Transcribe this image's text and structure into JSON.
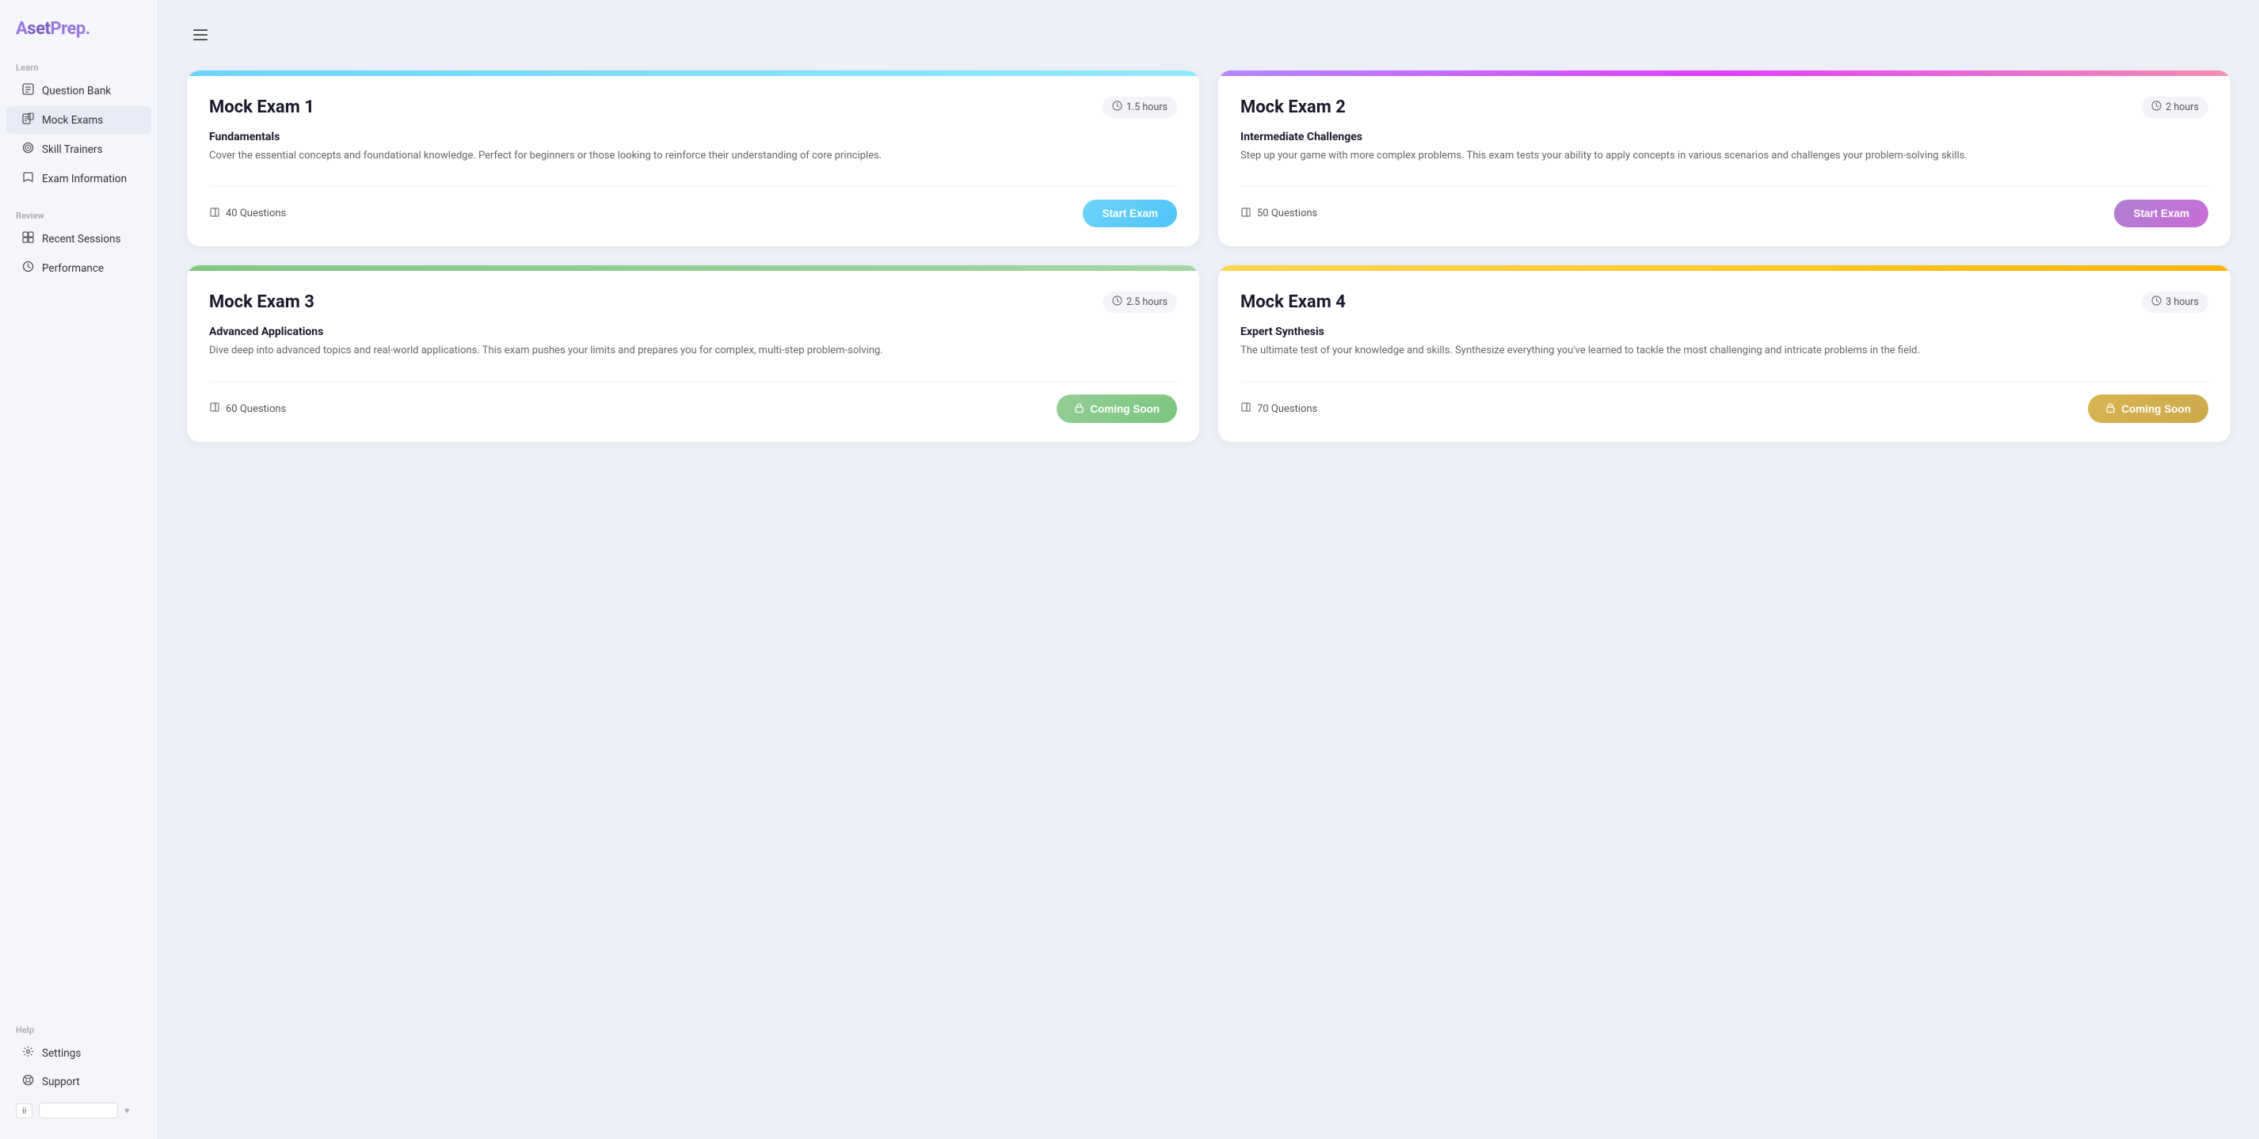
{
  "app": {
    "logo": "AsetPrep.",
    "logo_color_a": "#9b77e0",
    "logo_color_s": "#7c5cbf"
  },
  "sidebar": {
    "learn_label": "Learn",
    "review_label": "Review",
    "help_label": "Help",
    "nav_items_learn": [
      {
        "id": "question-bank",
        "label": "Question Bank",
        "icon": "☐"
      },
      {
        "id": "mock-exams",
        "label": "Mock Exams",
        "icon": "📋"
      },
      {
        "id": "skill-trainers",
        "label": "Skill Trainers",
        "icon": "🎯"
      },
      {
        "id": "exam-information",
        "label": "Exam Information",
        "icon": "📖"
      }
    ],
    "nav_items_review": [
      {
        "id": "recent-sessions",
        "label": "Recent Sessions",
        "icon": "⊞"
      },
      {
        "id": "performance",
        "label": "Performance",
        "icon": "⏱"
      }
    ],
    "nav_items_help": [
      {
        "id": "settings",
        "label": "Settings",
        "icon": "⚙"
      },
      {
        "id": "support",
        "label": "Support",
        "icon": "⊙"
      }
    ],
    "version": "ii",
    "version_placeholder": ""
  },
  "toolbar": {
    "toggle_label": "⊟"
  },
  "exams": [
    {
      "id": "mock-exam-1",
      "title": "Mock Exam 1",
      "duration": "1.5 hours",
      "subtitle": "Fundamentals",
      "description": "Cover the essential concepts and foundational knowledge. Perfect for beginners or those looking to reinforce their understanding of core principles.",
      "questions": "40 Questions",
      "cta_label": "Start Exam",
      "cta_type": "start",
      "card_class": "card-1",
      "btn_class": "btn-start-1"
    },
    {
      "id": "mock-exam-2",
      "title": "Mock Exam 2",
      "duration": "2 hours",
      "subtitle": "Intermediate Challenges",
      "description": "Step up your game with more complex problems. This exam tests your ability to apply concepts in various scenarios and challenges your problem-solving skills.",
      "questions": "50 Questions",
      "cta_label": "Start Exam",
      "cta_type": "start",
      "card_class": "card-2",
      "btn_class": "btn-start-2"
    },
    {
      "id": "mock-exam-3",
      "title": "Mock Exam 3",
      "duration": "2.5 hours",
      "subtitle": "Advanced Applications",
      "description": "Dive deep into advanced topics and real-world applications. This exam pushes your limits and prepares you for complex, multi-step problem-solving.",
      "questions": "60 Questions",
      "cta_label": "Coming Soon",
      "cta_type": "coming-soon",
      "card_class": "card-3",
      "btn_class": "btn-coming-soon-3"
    },
    {
      "id": "mock-exam-4",
      "title": "Mock Exam 4",
      "duration": "3 hours",
      "subtitle": "Expert Synthesis",
      "description": "The ultimate test of your knowledge and skills. Synthesize everything you've learned to tackle the most challenging and intricate problems in the field.",
      "questions": "70 Questions",
      "cta_label": "Coming Soon",
      "cta_type": "coming-soon",
      "card_class": "card-4",
      "btn_class": "btn-coming-soon-4"
    }
  ]
}
